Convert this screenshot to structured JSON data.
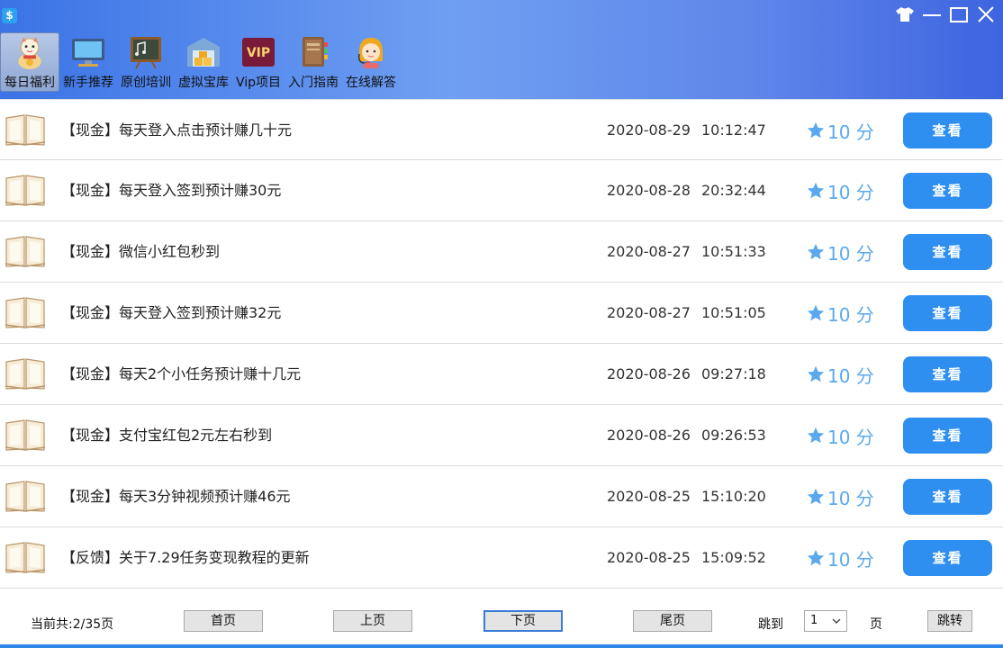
{
  "window": {
    "app_icon": "dollar-icon",
    "controls": [
      "shirt-icon",
      "minimize-icon",
      "maximize-icon",
      "close-icon"
    ]
  },
  "toolbar": {
    "items": [
      {
        "label": "每日福利",
        "icon": "lucky-cat-icon",
        "active": true
      },
      {
        "label": "新手推荐",
        "icon": "monitor-icon"
      },
      {
        "label": "原创培训",
        "icon": "chalkboard-icon"
      },
      {
        "label": "虚拟宝库",
        "icon": "warehouse-icon"
      },
      {
        "label": "Vip项目",
        "icon": "vip-icon",
        "badge": "VIP"
      },
      {
        "label": "入门指南",
        "icon": "guide-book-icon"
      },
      {
        "label": "在线解答",
        "icon": "support-agent-icon"
      }
    ]
  },
  "list": {
    "items": [
      {
        "title": "【现金】每天登入点击预计赚几十元",
        "date": "2020-08-29",
        "time": "10:12:47",
        "score": "10 分",
        "action": "查看"
      },
      {
        "title": "【现金】每天登入签到预计赚30元",
        "date": "2020-08-28",
        "time": "20:32:44",
        "score": "10 分",
        "action": "查看"
      },
      {
        "title": "【现金】微信小红包秒到",
        "date": "2020-08-27",
        "time": "10:51:33",
        "score": "10 分",
        "action": "查看"
      },
      {
        "title": "【现金】每天登入签到预计赚32元",
        "date": "2020-08-27",
        "time": "10:51:05",
        "score": "10 分",
        "action": "查看"
      },
      {
        "title": "【现金】每天2个小任务预计赚十几元",
        "date": "2020-08-26",
        "time": "09:27:18",
        "score": "10 分",
        "action": "查看"
      },
      {
        "title": "【现金】支付宝红包2元左右秒到",
        "date": "2020-08-26",
        "time": "09:26:53",
        "score": "10 分",
        "action": "查看"
      },
      {
        "title": "【现金】每天3分钟视频预计赚46元",
        "date": "2020-08-25",
        "time": "15:10:20",
        "score": "10 分",
        "action": "查看"
      },
      {
        "title": "【反馈】关于7.29任务变现教程的更新",
        "date": "2020-08-25",
        "time": "15:09:52",
        "score": "10 分",
        "action": "查看"
      }
    ]
  },
  "footer": {
    "status": "当前共:2/35页",
    "first": "首页",
    "prev": "上页",
    "next": "下页",
    "last": "尾页",
    "jump_label": "跳到",
    "jump_value": "1",
    "page_unit": "页",
    "go": "跳转"
  },
  "colors": {
    "accent": "#2e8ff0",
    "score": "#5aa9ee",
    "header_start": "#3b73e6",
    "header_end": "#3e64e0"
  }
}
